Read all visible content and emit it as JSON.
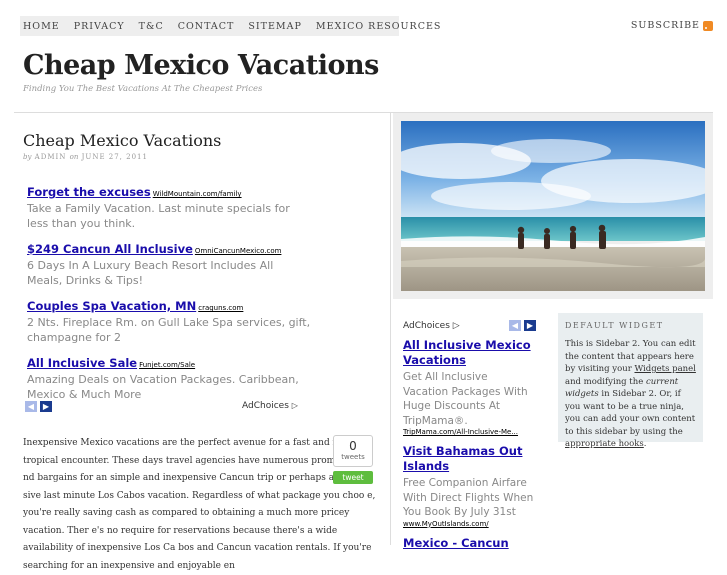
{
  "nav": {
    "items": [
      "HOME",
      "PRIVACY",
      "T&C",
      "CONTACT",
      "SITEMAP",
      "MEXICO RESOURCES"
    ],
    "subscribe": "SUBSCRIBE"
  },
  "header": {
    "title": "Cheap Mexico Vacations",
    "tagline": "Finding You The Best Vacations At The Cheapest Prices"
  },
  "post": {
    "title": "Cheap Mexico Vacations",
    "by": "by",
    "author": "ADMIN",
    "on": "on",
    "date": "JUNE 27, 2011",
    "body": "Inexpensive Mexico vacations are the perfect avenue for a fast and relaxing tropical encounter. These days travel agencies have numerous promotions a nd bargains for an simple and inexpensive Cancun trip or perhaps a inexpen sive last minute Los Cabos vacation. Regardless of what package you choo e, you're really saving cash as compared to obtaining a much more pricey vacation. Ther e's no require for reservations because there's a wide availability of inexpensive Los Ca bos and Cancun vacation rentals. If you're searching for an inexpensive and enjoyable en"
  },
  "ads": [
    {
      "title": "Forget the excuses",
      "url": "WildMountain.com/family",
      "desc": "Take a Family Vacation. Last minute specials for less than you think."
    },
    {
      "title": "$249 Cancun All Inclusive",
      "url": "OmniCancunMexico.com",
      "desc": "6 Days In A Luxury Beach Resort Includes All Meals, Drinks & Tips!"
    },
    {
      "title": "Couples Spa Vacation, MN",
      "url": "craguns.com",
      "desc": "2 Nts. Fireplace Rm. on Gull Lake Spa services, gift, champagne for 2"
    },
    {
      "title": "All Inclusive Sale",
      "url": "Funjet.com/Sale",
      "desc": "Amazing Deals on Vacation Packages. Caribbean, Mexico & Much More"
    }
  ],
  "adchoices": "AdChoices",
  "tweet": {
    "count": "0",
    "label": "tweets",
    "button": "tweet"
  },
  "sidebar_ads": [
    {
      "title": "All Inclusive Mexico Vacations",
      "desc": "Get All Inclusive Vacation Packages With Huge Discounts At TripMama®.",
      "url": "TripMama.com/All-Inclusive-Me..."
    },
    {
      "title": "Visit Bahamas Out Islands",
      "desc": "Free Companion Airfare With Direct Flights When You Book By July 31st",
      "url": "www.MyOutIslands.com/"
    },
    {
      "title": "Mexico - Cancun",
      "desc": "",
      "url": ""
    }
  ],
  "widget": {
    "title": "Default Widget",
    "p1": "This is Sidebar 2. You can edit the content that appears here by visiting your ",
    "link1": "Widgets panel",
    "p2": " and modifying the ",
    "em": "current widgets",
    "p3": " in Sidebar 2. Or, if you want to be a true ninja, you can add your own content to this sidebar by using the ",
    "link2": "appropriate hooks",
    "p4": "."
  },
  "colors": {
    "ad_link": "#1a0dab",
    "ad_nav_dark": "#1a3b8f",
    "ad_nav_light": "#a9b9e8",
    "tweet_green": "#5ebd3e",
    "rss": "#f08a24",
    "widget_bg": "#e9eef0"
  },
  "icons": [
    "rss-icon",
    "chevron-left-icon",
    "chevron-right-icon",
    "adchoices-icon"
  ]
}
